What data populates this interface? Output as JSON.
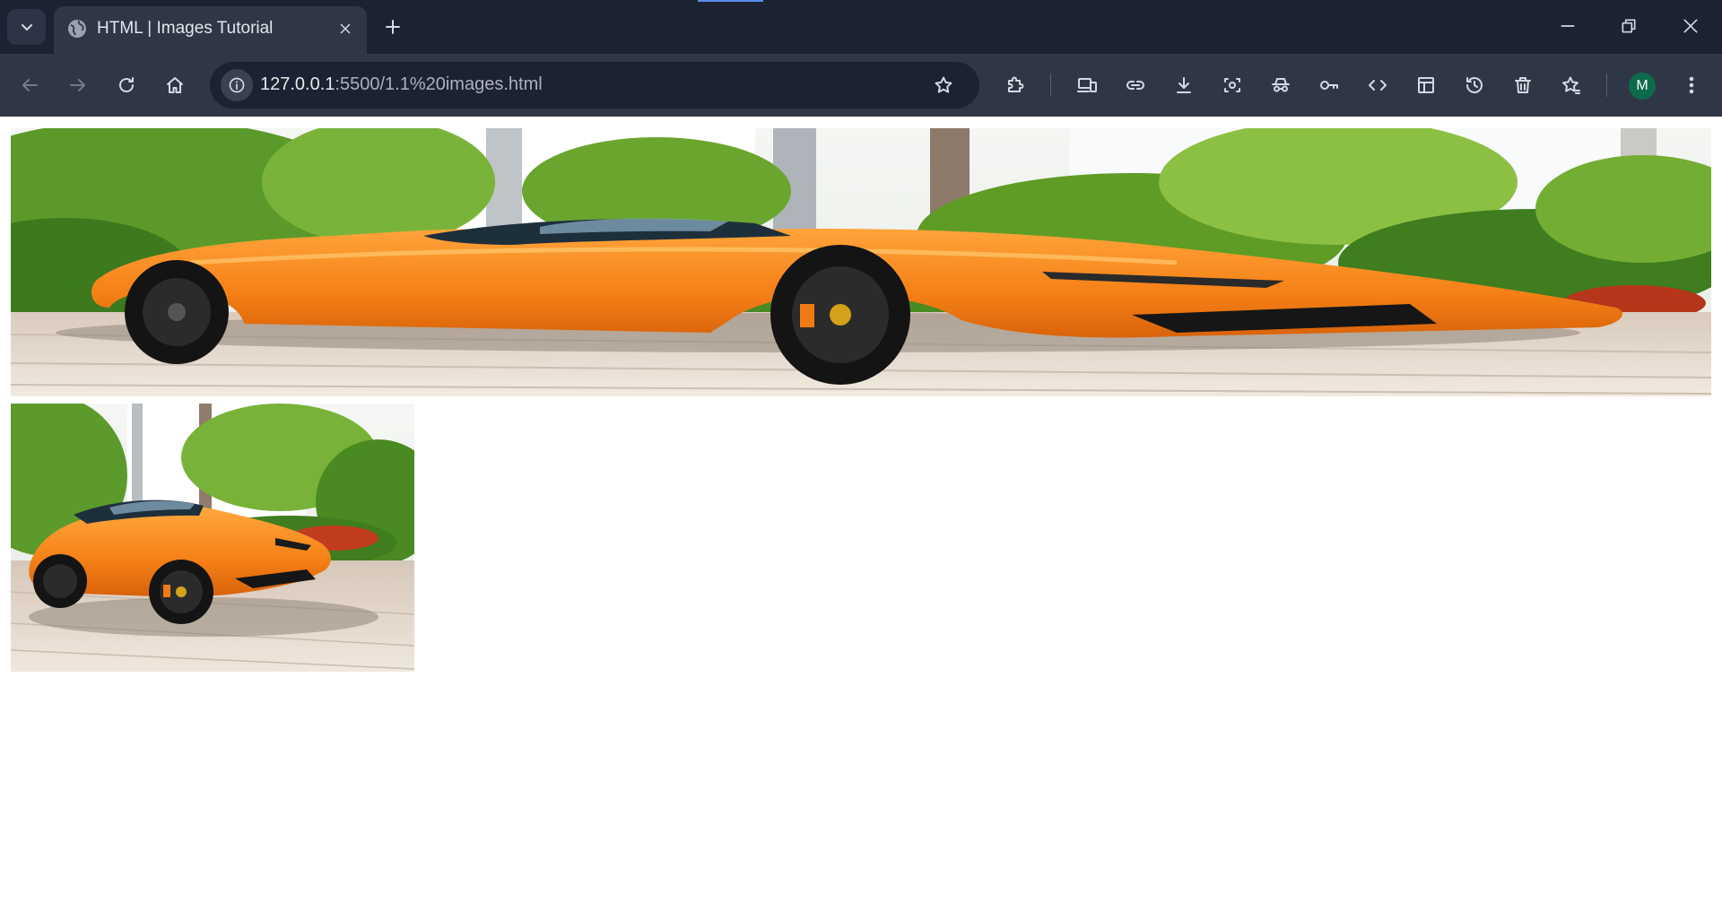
{
  "browser": {
    "tab": {
      "title": "HTML | Images Tutorial"
    },
    "address_bar": {
      "host": "127.0.0.1",
      "path": ":5500/1.1%20images.html"
    },
    "profile_initial": "M"
  },
  "page": {
    "images": [
      {
        "subject": "orange sports car (stretched)"
      },
      {
        "subject": "orange sports car"
      }
    ]
  },
  "icons": {
    "tab_search": "chevron-down-icon",
    "favicon": "globe-icon",
    "tab_close": "close-icon",
    "new_tab": "plus-icon",
    "back": "arrow-left-icon",
    "forward": "arrow-right-icon",
    "reload": "reload-icon",
    "home": "home-icon",
    "site_info": "info-icon",
    "bookmark": "star-icon",
    "extensions": "puzzle-icon",
    "devices": "devices-icon",
    "link": "link-icon",
    "download": "download-icon",
    "screenshot": "screenshot-icon",
    "incognito": "incognito-icon",
    "passwords": "key-icon",
    "devtools": "code-icon",
    "layout": "layout-icon",
    "history": "history-icon",
    "delete": "trash-icon",
    "bookmarks_manager": "star-list-icon",
    "menu": "kebab-menu-icon"
  },
  "colors": {
    "tabstrip_bg": "#1b2231",
    "toolbar_bg": "#2f3747",
    "car_orange": "#f5821f",
    "profile_green": "#0c6b4a"
  }
}
